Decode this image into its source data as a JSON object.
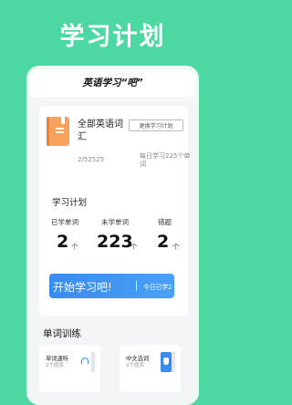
{
  "hero": {
    "title": "学习计划"
  },
  "app": {
    "header_title": "英语学习“吧”"
  },
  "book": {
    "title": "全部英语词汇",
    "change_label": "更换学习计划",
    "progress": "2/52525",
    "daily": "每日学习225个单词"
  },
  "plan": {
    "title": "学习计划",
    "stats": [
      {
        "label": "已学单词",
        "value": "2",
        "unit": "个"
      },
      {
        "label": "未学单词",
        "value": "223",
        "unit": "个"
      },
      {
        "label": "错题",
        "value": "2",
        "unit": "个"
      }
    ],
    "start_label": "开始学习吧!",
    "start_sub": "今日已学2"
  },
  "training": {
    "title": "单词训练",
    "items": [
      {
        "name": "单词速听",
        "count": "2个题库",
        "icon": "headphone-icon"
      },
      {
        "name": "中文选词",
        "count": "2个题库",
        "icon": "hand-icon"
      }
    ]
  },
  "colors": {
    "background": "#4cd7a3",
    "accent_blue": "#3a8bf0",
    "book_orange": "#f6a25c"
  }
}
